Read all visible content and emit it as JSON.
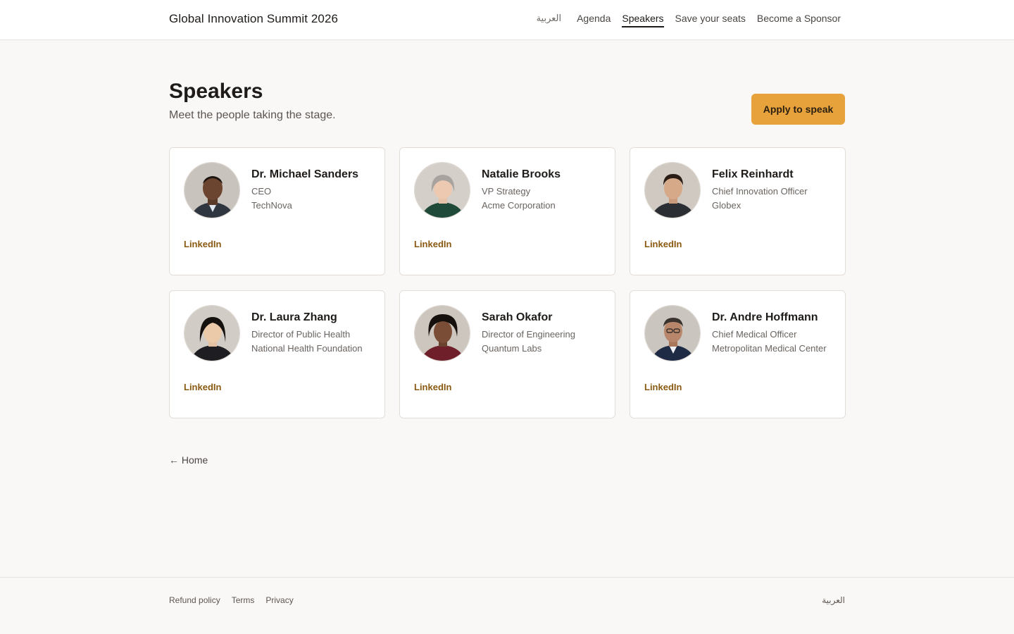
{
  "header": {
    "brand": "Global Innovation Summit 2026",
    "nav": {
      "lang": "العربية",
      "agenda": "Agenda",
      "speakers": "Speakers",
      "seats": "Save your seats",
      "sponsor": "Become a Sponsor"
    }
  },
  "page": {
    "title": "Speakers",
    "subtitle": "Meet the people taking the stage.",
    "apply_label": "Apply to speak"
  },
  "speakers": [
    {
      "name": "Dr. Michael Sanders",
      "role": "CEO",
      "org": "TechNova",
      "link": "LinkedIn"
    },
    {
      "name": "Natalie Brooks",
      "role": "VP Strategy",
      "org": "Acme Corporation",
      "link": "LinkedIn"
    },
    {
      "name": "Felix Reinhardt",
      "role": "Chief Innovation Officer",
      "org": "Globex",
      "link": "LinkedIn"
    },
    {
      "name": "Dr. Laura Zhang",
      "role": "Director of Public Health",
      "org": "National Health Foundation",
      "link": "LinkedIn"
    },
    {
      "name": "Sarah Okafor",
      "role": "Director of Engineering",
      "org": "Quantum Labs",
      "link": "LinkedIn"
    },
    {
      "name": "Dr. Andre Hoffmann",
      "role": "Chief Medical Officer",
      "org": "Metropolitan Medical Center",
      "link": "LinkedIn"
    }
  ],
  "back": {
    "label": "← Home"
  },
  "footer": {
    "refund": "Refund policy",
    "terms": "Terms",
    "privacy": "Privacy",
    "lang": "العربية"
  },
  "colors": {
    "accent": "#e8a23b",
    "link": "#8a5a12",
    "background": "#faf8f7"
  }
}
